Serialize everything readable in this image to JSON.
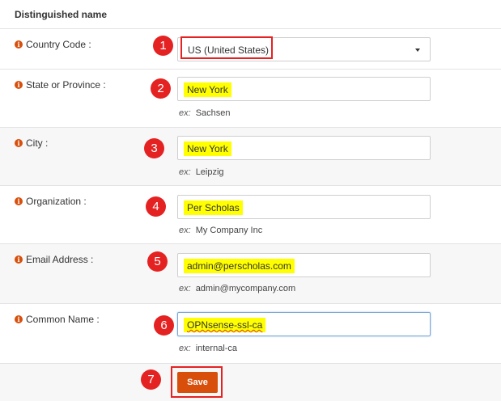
{
  "section": {
    "title": "Distinguished name"
  },
  "colors": {
    "info_icon": "#d84f0c",
    "badge": "#e52222",
    "highlight": "#ffff00",
    "save_button": "#d84f0c"
  },
  "fields": {
    "country": {
      "label": "Country Code :",
      "value": "US (United States)"
    },
    "state": {
      "label": "State or Province :",
      "value": "New York",
      "hint_prefix": "ex:",
      "hint": "Sachsen"
    },
    "city": {
      "label": "City :",
      "value": "New York",
      "hint_prefix": "ex:",
      "hint": "Leipzig"
    },
    "organization": {
      "label": "Organization :",
      "value": "Per Scholas",
      "hint_prefix": "ex:",
      "hint": "My Company Inc"
    },
    "email": {
      "label": "Email Address :",
      "value": "admin@perscholas.com",
      "hint_prefix": "ex:",
      "hint": "admin@mycompany.com"
    },
    "common_name": {
      "label": "Common Name :",
      "value": "OPNsense-ssl-ca",
      "hint_prefix": "ex:",
      "hint": "internal-ca"
    }
  },
  "badges": [
    "1",
    "2",
    "3",
    "4",
    "5",
    "6",
    "7"
  ],
  "save_button": {
    "label": "Save"
  },
  "icons": {
    "info": "info-circle-icon",
    "dropdown": "caret-down-icon"
  }
}
